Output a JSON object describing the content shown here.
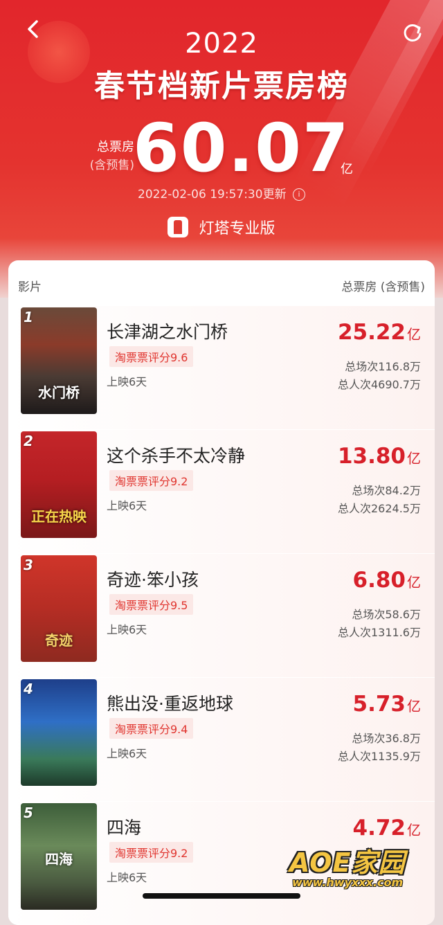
{
  "header": {
    "year": "2022",
    "title": "春节档新片票房榜",
    "total_label": "总票房",
    "total_label_sub": "(含预售)",
    "total_value": "60.07",
    "total_unit": "亿",
    "update_time": "2022-02-06 19:57:30更新",
    "info_icon": "i",
    "brand": "灯塔专业版"
  },
  "list": {
    "col_left": "影片",
    "col_right": "总票房 (含预售)",
    "items": [
      {
        "rank": "1",
        "name": "长津湖之水门桥",
        "poster_text": "水门桥",
        "score": "淘票票评分9.6",
        "days": "上映6天",
        "box": "25.22",
        "unit": "亿",
        "shows": "总场次116.8万",
        "audience": "总人次4690.7万"
      },
      {
        "rank": "2",
        "name": "这个杀手不太冷静",
        "poster_text": "正在热映",
        "score": "淘票票评分9.2",
        "days": "上映6天",
        "box": "13.80",
        "unit": "亿",
        "shows": "总场次84.2万",
        "audience": "总人次2624.5万"
      },
      {
        "rank": "3",
        "name": "奇迹·笨小孩",
        "poster_text": "奇迹",
        "score": "淘票票评分9.5",
        "days": "上映6天",
        "box": "6.80",
        "unit": "亿",
        "shows": "总场次58.6万",
        "audience": "总人次1311.6万"
      },
      {
        "rank": "4",
        "name": "熊出没·重返地球",
        "poster_text": "",
        "score": "淘票票评分9.4",
        "days": "上映6天",
        "box": "5.73",
        "unit": "亿",
        "shows": "总场次36.8万",
        "audience": "总人次1135.9万"
      },
      {
        "rank": "5",
        "name": "四海",
        "poster_text": "四海",
        "score": "淘票票评分9.2",
        "days": "上映6天",
        "box": "4.72",
        "unit": "亿",
        "shows": "",
        "audience": ""
      }
    ]
  },
  "watermark": {
    "text": "AOE家园",
    "url": "www.hwyxxx.com"
  },
  "colors": {
    "brand_red": "#e2262c",
    "value_red": "#d7202a",
    "score_bg": "#fbe8e6"
  }
}
